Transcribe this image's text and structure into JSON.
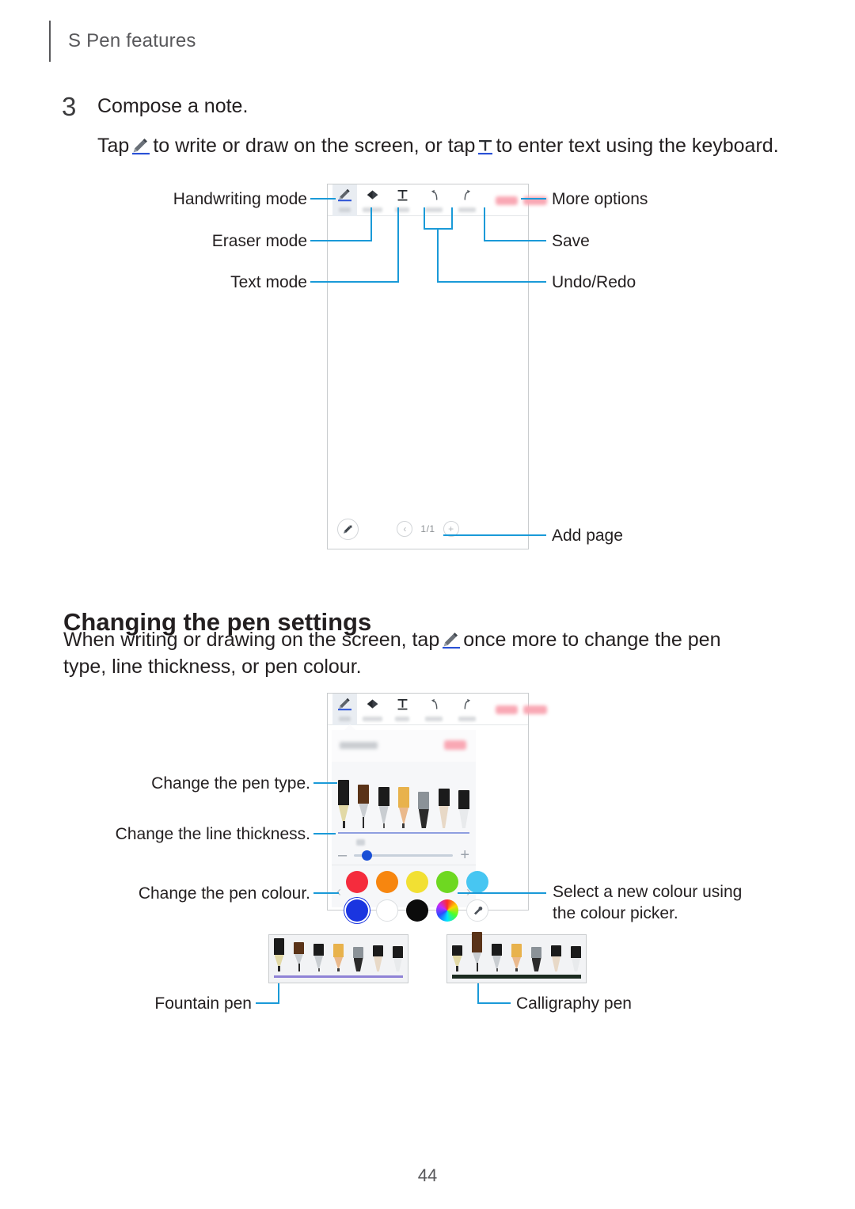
{
  "running_head": "S Pen features",
  "step": {
    "number": "3",
    "title": "Compose a note.",
    "line2_before": "Tap",
    "line2_mid": "to write or draw on the screen, or tap",
    "line2_after": "to enter text using the keyboard.",
    "pen_icon": "pen-icon",
    "text_icon": "text-icon"
  },
  "figure1": {
    "toolbar": {
      "items": [
        {
          "name": "pen",
          "label": "Pen",
          "icon": "pen-icon",
          "selected": true
        },
        {
          "name": "eraser",
          "label": "Eraser",
          "icon": "eraser-icon",
          "selected": false
        },
        {
          "name": "text",
          "label": "Text",
          "icon": "text-icon",
          "selected": false
        },
        {
          "name": "undo",
          "label": "Undo",
          "icon": "undo-icon",
          "selected": false
        },
        {
          "name": "redo",
          "label": "Redo",
          "icon": "redo-icon",
          "selected": false
        }
      ],
      "save_label": "SAVE",
      "more_label": "MORE"
    },
    "bottom": {
      "pen_tool_icon": "pen-tool-icon",
      "prev_icon": "chevron-left-icon",
      "page_indicator": "1/1",
      "add_icon": "plus-icon"
    },
    "callouts": {
      "handwriting_mode": "Handwriting mode",
      "eraser_mode": "Eraser mode",
      "text_mode": "Text mode",
      "more_options": "More options",
      "save": "Save",
      "undo_redo": "Undo/Redo",
      "add_page": "Add page"
    }
  },
  "section": {
    "heading": "Changing the pen settings",
    "paragraph_part1": "When writing or drawing on the screen, tap",
    "paragraph_part2": "once more to change the pen type, line thickness, or pen colour.",
    "pen_icon": "pen-icon"
  },
  "figure2": {
    "toolbar": {
      "items": [
        {
          "name": "pen",
          "label": "Pen",
          "icon": "pen-icon",
          "selected": true
        },
        {
          "name": "eraser",
          "label": "Eraser",
          "icon": "eraser-icon",
          "selected": false
        },
        {
          "name": "text",
          "label": "Text",
          "icon": "text-icon",
          "selected": false
        },
        {
          "name": "undo",
          "label": "Undo",
          "icon": "undo-icon",
          "selected": false
        },
        {
          "name": "redo",
          "label": "Redo",
          "icon": "redo-icon",
          "selected": false
        }
      ],
      "save_label": "SAVE",
      "more_label": "MORE"
    },
    "panel": {
      "title": "Pen settings",
      "close_label": "CLOSE",
      "pen_types": [
        {
          "name": "fountain-pen",
          "cap": "#1b1b1b",
          "nib": "#e2d9a6",
          "selected": true
        },
        {
          "name": "calligraphy-pen",
          "cap": "#5a3318",
          "nib": "#c9cdd1",
          "selected": false
        },
        {
          "name": "pen",
          "cap": "#1b1b1b",
          "nib": "#c9cdd1",
          "selected": false
        },
        {
          "name": "pencil",
          "cap": "#e8b24c",
          "nib": "#eab98c",
          "selected": false
        },
        {
          "name": "marker",
          "cap": "#8b9298",
          "nib": "#2a2a2a",
          "selected": false
        },
        {
          "name": "brush",
          "cap": "#1b1b1b",
          "nib": "#e8d9c7",
          "selected": false
        },
        {
          "name": "highlighter",
          "cap": "#1b1b1b",
          "nib": "#e8eaec",
          "selected": false
        }
      ],
      "thickness": {
        "minus_label": "–",
        "plus_label": "+",
        "value_pct": 12,
        "bubble": "thickness-preview"
      },
      "colours": {
        "prev_icon": "chevron-left-icon",
        "next_icon": "chevron-right-icon",
        "row1": [
          "#f52c3d",
          "#f7860f",
          "#f2e033",
          "#6ed821",
          "#47c6f2"
        ],
        "row2": [
          "#1a35e0",
          "#ffffff",
          "#0b0b0b",
          "rainbow",
          "eyedropper"
        ],
        "selected": "#1a35e0",
        "eyedropper_icon": "eyedropper-icon"
      }
    },
    "callouts": {
      "pen_type": "Change the pen type.",
      "line_thickness": "Change the line thickness.",
      "pen_colour": "Change the pen colour.",
      "colour_picker": "Select a new colour using the colour picker."
    }
  },
  "samples": {
    "left": {
      "label": "Fountain pen",
      "highlight_index": 0,
      "underline_colour": "#8f82d6",
      "pens": [
        {
          "cap": "#1b1b1b",
          "nib": "#e2d9a6"
        },
        {
          "cap": "#5a3318",
          "nib": "#c9cdd1"
        },
        {
          "cap": "#1b1b1b",
          "nib": "#c9cdd1"
        },
        {
          "cap": "#e8b24c",
          "nib": "#eab98c"
        },
        {
          "cap": "#8b9298",
          "nib": "#2a2a2a"
        },
        {
          "cap": "#1b1b1b",
          "nib": "#e8d9c7"
        },
        {
          "cap": "#1b1b1b",
          "nib": "#e8eaec"
        }
      ]
    },
    "right": {
      "label": "Calligraphy pen",
      "highlight_index": 1,
      "underline_colour": "#1b2b20",
      "pens": [
        {
          "cap": "#1b1b1b",
          "nib": "#e2d9a6"
        },
        {
          "cap": "#5a3318",
          "nib": "#c9cdd1"
        },
        {
          "cap": "#1b1b1b",
          "nib": "#c9cdd1"
        },
        {
          "cap": "#e8b24c",
          "nib": "#eab98c"
        },
        {
          "cap": "#8b9298",
          "nib": "#2a2a2a"
        },
        {
          "cap": "#1b1b1b",
          "nib": "#e8d9c7"
        },
        {
          "cap": "#1b1b1b",
          "nib": "#e8eaec"
        }
      ]
    }
  },
  "folio": "44",
  "colors": {
    "leader": "#1a9ad8",
    "text": "#231f20",
    "muted": "#58585b"
  }
}
